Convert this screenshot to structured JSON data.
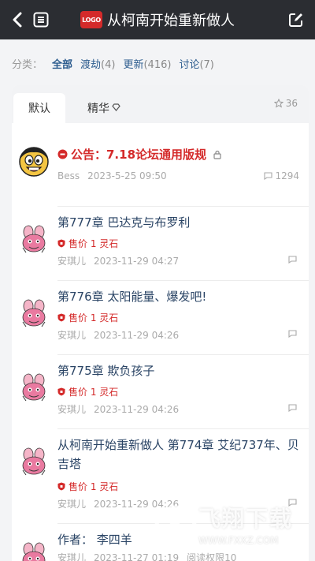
{
  "header": {
    "title": "从柯南开始重新做人",
    "logo_text": "LOGO",
    "icons": {
      "back": "back-arrow-icon",
      "menu": "list-menu-icon",
      "edit": "edit-icon"
    }
  },
  "filter": {
    "label": "分类：",
    "options": [
      {
        "label": "全部",
        "count": ""
      },
      {
        "label": "渡劫",
        "count": "(4)"
      },
      {
        "label": "更新",
        "count": "(416)"
      },
      {
        "label": "讨论",
        "count": "(7)"
      }
    ]
  },
  "tabs": [
    {
      "label": "默认"
    },
    {
      "label": "精华"
    }
  ],
  "favorites": "36",
  "colors": {
    "accent": "#2c5c8e",
    "announcement": "#d42a2a",
    "header_bg": "#2b2d32"
  },
  "announcement": {
    "title": "公告：7.18论坛通用版规",
    "author": "Bess",
    "date": "2023-5-25 09:50",
    "comments": "1294"
  },
  "posts": [
    {
      "title": "第777章 巴达克与布罗利",
      "price": "售价 1 灵石",
      "author": "安琪儿",
      "date": "2023-11-29 04:27"
    },
    {
      "title": "第776章 太阳能量、爆发吧!",
      "price": "售价 1 灵石",
      "author": "安琪儿",
      "date": "2023-11-29 04:26"
    },
    {
      "title": "第775章 欺负孩子",
      "price": "售价 1 灵石",
      "author": "安琪儿",
      "date": "2023-11-29 04:26"
    },
    {
      "title": "从柯南开始重新做人 第774章 艾纪737年、贝吉塔",
      "price": "售价 1 灵石",
      "author": "安琪儿",
      "date": "2023-11-29 04:26"
    },
    {
      "title": "作者：  李四羊",
      "price": "",
      "author": "安琪儿",
      "date": "2023-11-27 01:19",
      "extra": "阅读权限10"
    }
  ],
  "watermark": {
    "text": "飞翔下载",
    "url": "WWW.FXXZ.COM"
  }
}
